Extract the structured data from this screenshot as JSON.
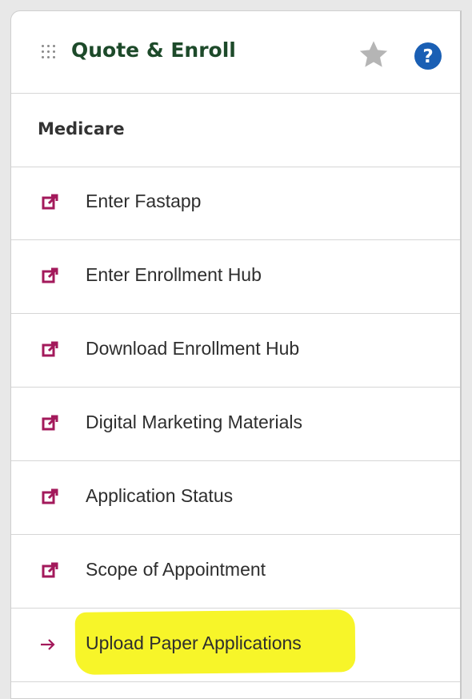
{
  "panel": {
    "title": "Quote & Enroll",
    "section_label": "Medicare"
  },
  "items": [
    {
      "label": "Enter Fastapp",
      "icon": "external-link-icon"
    },
    {
      "label": "Enter Enrollment Hub",
      "icon": "external-link-icon"
    },
    {
      "label": "Download Enrollment Hub",
      "icon": "external-link-icon"
    },
    {
      "label": "Digital Marketing Materials",
      "icon": "external-link-icon"
    },
    {
      "label": "Application Status",
      "icon": "external-link-icon"
    },
    {
      "label": "Scope of Appointment",
      "icon": "external-link-icon"
    },
    {
      "label": "Upload Paper Applications",
      "icon": "arrow-right-icon"
    }
  ],
  "colors": {
    "title_green": "#1d4a2a",
    "icon_magenta": "#a3195b",
    "help_blue": "#1a5fb4",
    "star_gray": "#b5b5b5",
    "highlight_yellow": "#f7f529"
  }
}
